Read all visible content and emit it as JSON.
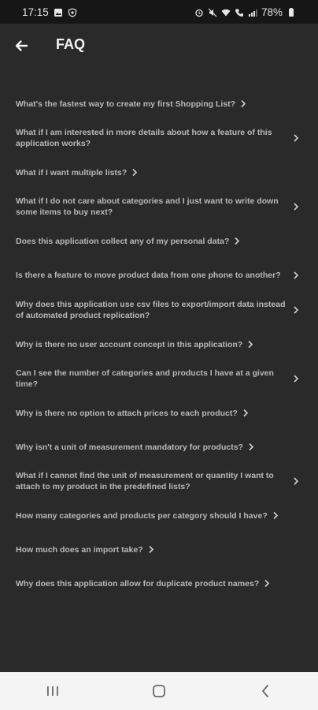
{
  "status": {
    "time": "17:15",
    "battery": "78%"
  },
  "app": {
    "title": "FAQ"
  },
  "faq": [
    {
      "q": "What's the fastest way to create my first Shopping List?",
      "lines": 1
    },
    {
      "q": "What if I am interested in more details about how a feature of this application works?",
      "lines": 2
    },
    {
      "q": "What if I want multiple lists?",
      "lines": 1
    },
    {
      "q": "What if I do not care about categories and I just want to write down some items to buy next?",
      "lines": 2
    },
    {
      "q": "Does this application collect any of my personal data?",
      "lines": 1
    },
    {
      "q": "Is there a feature to move product data from one phone to another?",
      "lines": 2
    },
    {
      "q": "Why does this application use csv files to export/import data instead of automated product replication?",
      "lines": 2
    },
    {
      "q": "Why is there no user account concept in this application?",
      "lines": 1
    },
    {
      "q": "Can I see the number of categories and products I have at a given time?",
      "lines": 2
    },
    {
      "q": "Why is there no option to attach prices to each product?",
      "lines": 1
    },
    {
      "q": "Why isn't a unit of measurement mandatory for products?",
      "lines": 1
    },
    {
      "q": "What if I cannot find the unit of measurement or quantity I want to attach to my product in the predefined lists?",
      "lines": 2
    },
    {
      "q": "How many categories and products per category should I have?",
      "lines": 1
    },
    {
      "q": "How much does an import take?",
      "lines": 1
    },
    {
      "q": "Why does this application allow for duplicate product names?",
      "lines": 1
    }
  ]
}
